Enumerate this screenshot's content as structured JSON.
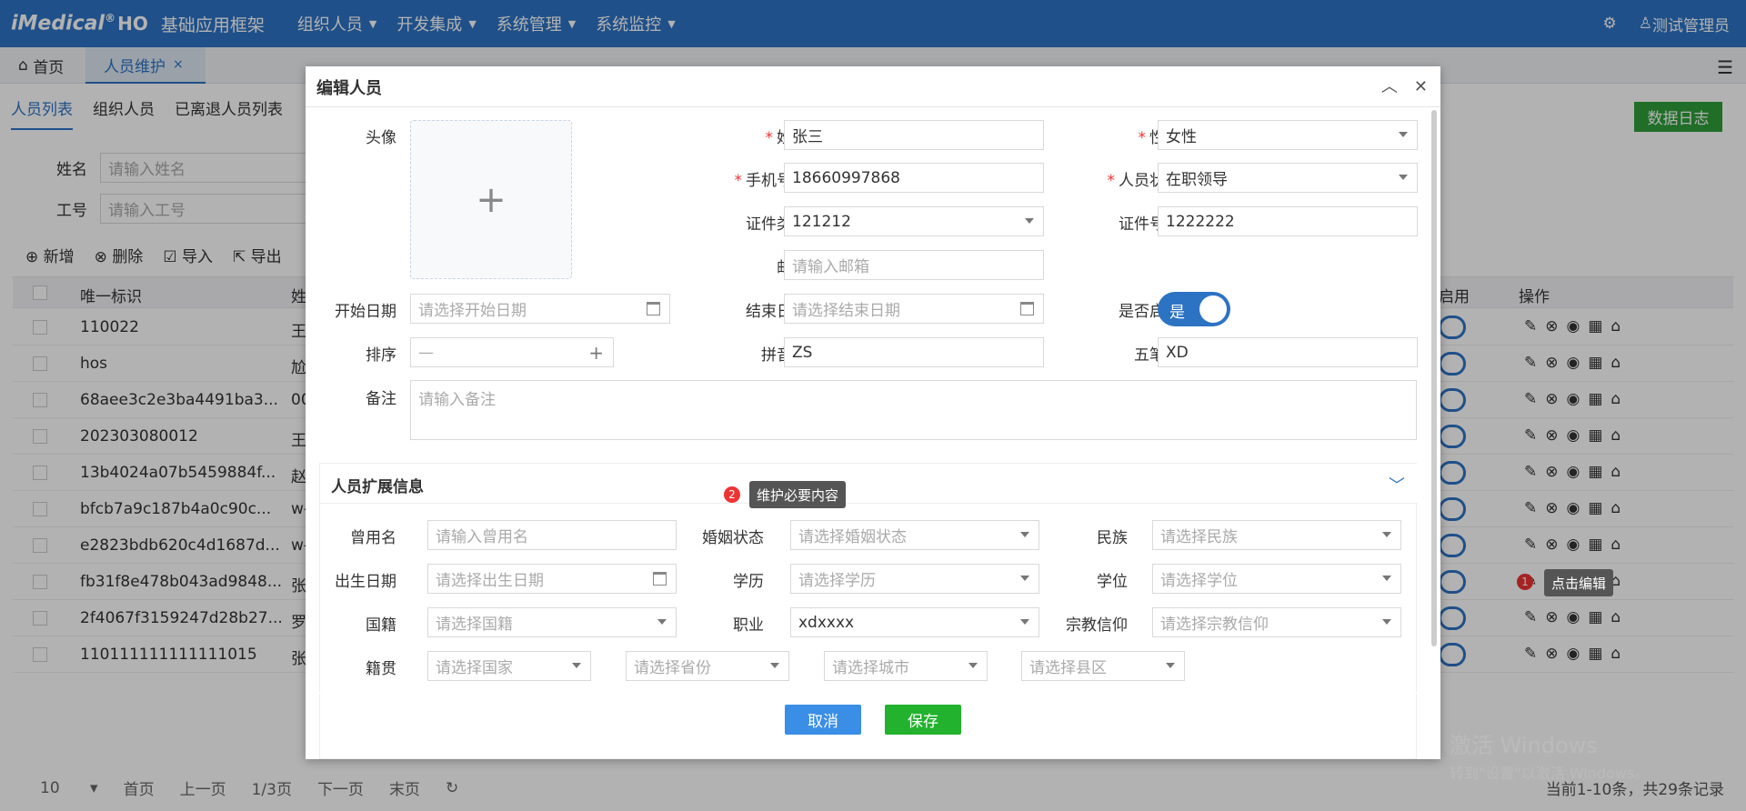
{
  "app": {
    "logo": "iMedical",
    "logo_sup": "®",
    "logo_ho": "HO",
    "title": "基础应用框架",
    "menu": [
      "组织人员",
      "开发集成",
      "系统管理",
      "系统监控"
    ],
    "user": "测试管理员"
  },
  "tabs": {
    "home": "首页",
    "active": "人员维护",
    "close": "×"
  },
  "subtabs": [
    "人员列表",
    "组织人员",
    "已离退人员列表"
  ],
  "datalog": "数据日志",
  "filters": {
    "name_label": "姓名",
    "name_ph": "请输入姓名",
    "code_label": "工号",
    "code_ph": "请输入工号"
  },
  "toolbar": [
    "新增",
    "删除",
    "导入",
    "导出"
  ],
  "grid": {
    "headers": {
      "id": "唯一标识",
      "name": "姓",
      "enabled": "启用",
      "ops": "操作"
    },
    "rows": [
      {
        "id": "110022",
        "name": "王"
      },
      {
        "id": "hos",
        "name": "尬"
      },
      {
        "id": "68aee3c2e3ba4491ba3...",
        "name": "00"
      },
      {
        "id": "202303080012",
        "name": "王"
      },
      {
        "id": "13b4024a07b5459884f...",
        "name": "赵"
      },
      {
        "id": "bfcb7a9c187b4a0c90c...",
        "name": "w-"
      },
      {
        "id": "e2823bdb620c4d1687d...",
        "name": "w-"
      },
      {
        "id": "fb31f8e478b043ad9848...",
        "name": "张"
      },
      {
        "id": "2f4067f3159247d28b27...",
        "name": "罗"
      },
      {
        "id": "110111111111111015",
        "name": "张"
      }
    ]
  },
  "footer": {
    "size": "10",
    "first": "首页",
    "prev": "上一页",
    "page": "1/3页",
    "next": "下一页",
    "last": "末页",
    "info": "当前1-10条，共29条记录"
  },
  "watermark": {
    "line1": "激活 Windows",
    "line2": "转到\"设置\"以激活 Windows。"
  },
  "dialog": {
    "title": "编辑人员",
    "avatar_label": "头像",
    "name": {
      "label": "姓名",
      "value": "张三"
    },
    "gender": {
      "label": "性别",
      "value": "女性"
    },
    "phone": {
      "label": "手机号码",
      "value": "18660997868"
    },
    "status": {
      "label": "人员状态",
      "value": "在职领导"
    },
    "idtype": {
      "label": "证件类型",
      "value": "121212"
    },
    "idno": {
      "label": "证件号码",
      "value": "1222222"
    },
    "email": {
      "label": "邮箱",
      "ph": "请输入邮箱"
    },
    "start": {
      "label": "开始日期",
      "ph": "请选择开始日期"
    },
    "end": {
      "label": "结束日期",
      "ph": "请选择结束日期"
    },
    "enabled": {
      "label": "是否启用",
      "value": "是"
    },
    "order": {
      "label": "排序",
      "minus": "—",
      "plus": "+"
    },
    "pinyin": {
      "label": "拼音码",
      "value": "ZS"
    },
    "wubi": {
      "label": "五笔码",
      "value": "XD"
    },
    "remark": {
      "label": "备注",
      "ph": "请输入备注"
    },
    "ext": {
      "title": "人员扩展信息",
      "formername": {
        "label": "曾用名",
        "ph": "请输入曾用名"
      },
      "marital": {
        "label": "婚姻状态",
        "ph": "请选择婚姻状态"
      },
      "ethnic": {
        "label": "民族",
        "ph": "请选择民族"
      },
      "birth": {
        "label": "出生日期",
        "ph": "请选择出生日期"
      },
      "edu": {
        "label": "学历",
        "ph": "请选择学历"
      },
      "degree": {
        "label": "学位",
        "ph": "请选择学位"
      },
      "nation": {
        "label": "国籍",
        "ph": "请选择国籍"
      },
      "job": {
        "label": "职业",
        "value": "xdxxxx"
      },
      "religion": {
        "label": "宗教信仰",
        "ph": "请选择宗教信仰"
      },
      "origin": {
        "label": "籍贯",
        "country": "请选择国家",
        "province": "请选择省份",
        "city": "请选择城市",
        "county": "请选择县区"
      }
    },
    "cancel": "取消",
    "save": "保存"
  },
  "hints": {
    "n1": "1",
    "t1": "点击编辑",
    "n2": "2",
    "t2": "维护必要内容"
  }
}
